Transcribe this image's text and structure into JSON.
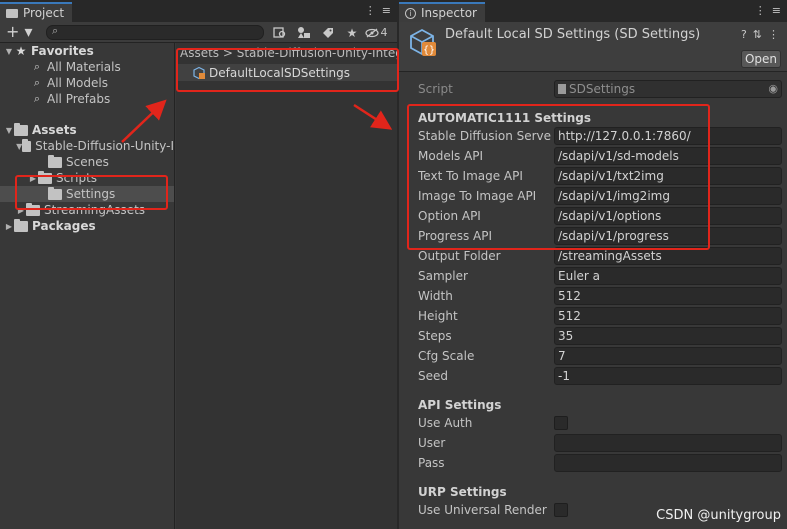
{
  "project": {
    "tab_label": "Project",
    "tab_icons": [
      "⋮",
      "≡"
    ],
    "add_button": "+ ▾",
    "search_icon": "⌕",
    "hidden_count": "4",
    "tree": {
      "favorites": "Favorites",
      "favorites_items": [
        "All Materials",
        "All Models",
        "All Prefabs"
      ],
      "assets": "Assets",
      "project_folder": "Stable-Diffusion-Unity-I",
      "subfolders": [
        "Scenes",
        "Scripts",
        "Settings"
      ],
      "streaming": "StreamingAssets",
      "packages": "Packages"
    },
    "breadcrumb": "Assets  >  Stable-Diffusion-Unity-Integ",
    "asset_name": "DefaultLocalSDSettings"
  },
  "inspector": {
    "tab_label": "Inspector",
    "tab_icons": [
      "⋮",
      "≡"
    ],
    "title": "Default Local SD Settings (SD Settings)",
    "header_icons": [
      "?",
      "⇅",
      "⋮"
    ],
    "open_button": "Open",
    "script_label": "Script",
    "script_value": "SDSettings",
    "section_automatic": "AUTOMATIC1111 Settings",
    "fields": [
      {
        "label": "Stable Diffusion Server U",
        "value": "http://127.0.0.1:7860/"
      },
      {
        "label": "Models API",
        "value": "/sdapi/v1/sd-models"
      },
      {
        "label": "Text To Image API",
        "value": "/sdapi/v1/txt2img"
      },
      {
        "label": "Image To Image API",
        "value": "/sdapi/v1/img2img"
      },
      {
        "label": "Option API",
        "value": "/sdapi/v1/options"
      },
      {
        "label": "Progress API",
        "value": "/sdapi/v1/progress"
      },
      {
        "label": "Output Folder",
        "value": "/streamingAssets"
      },
      {
        "label": "Sampler",
        "value": "Euler a"
      },
      {
        "label": "Width",
        "value": "512"
      },
      {
        "label": "Height",
        "value": "512"
      },
      {
        "label": "Steps",
        "value": "35"
      },
      {
        "label": "Cfg Scale",
        "value": "7"
      },
      {
        "label": "Seed",
        "value": "-1"
      }
    ],
    "section_api": "API Settings",
    "use_auth_label": "Use Auth",
    "user_label": "User",
    "user_value": "",
    "pass_label": "Pass",
    "pass_value": "",
    "section_urp": "URP Settings",
    "urp_label": "Use Universal Render Pi"
  },
  "watermark": "CSDN @unitygroup",
  "colors": {
    "annotation_red": "#e1251b",
    "tab_accent": "#3a79bb",
    "selection": "#4d4d4d"
  }
}
